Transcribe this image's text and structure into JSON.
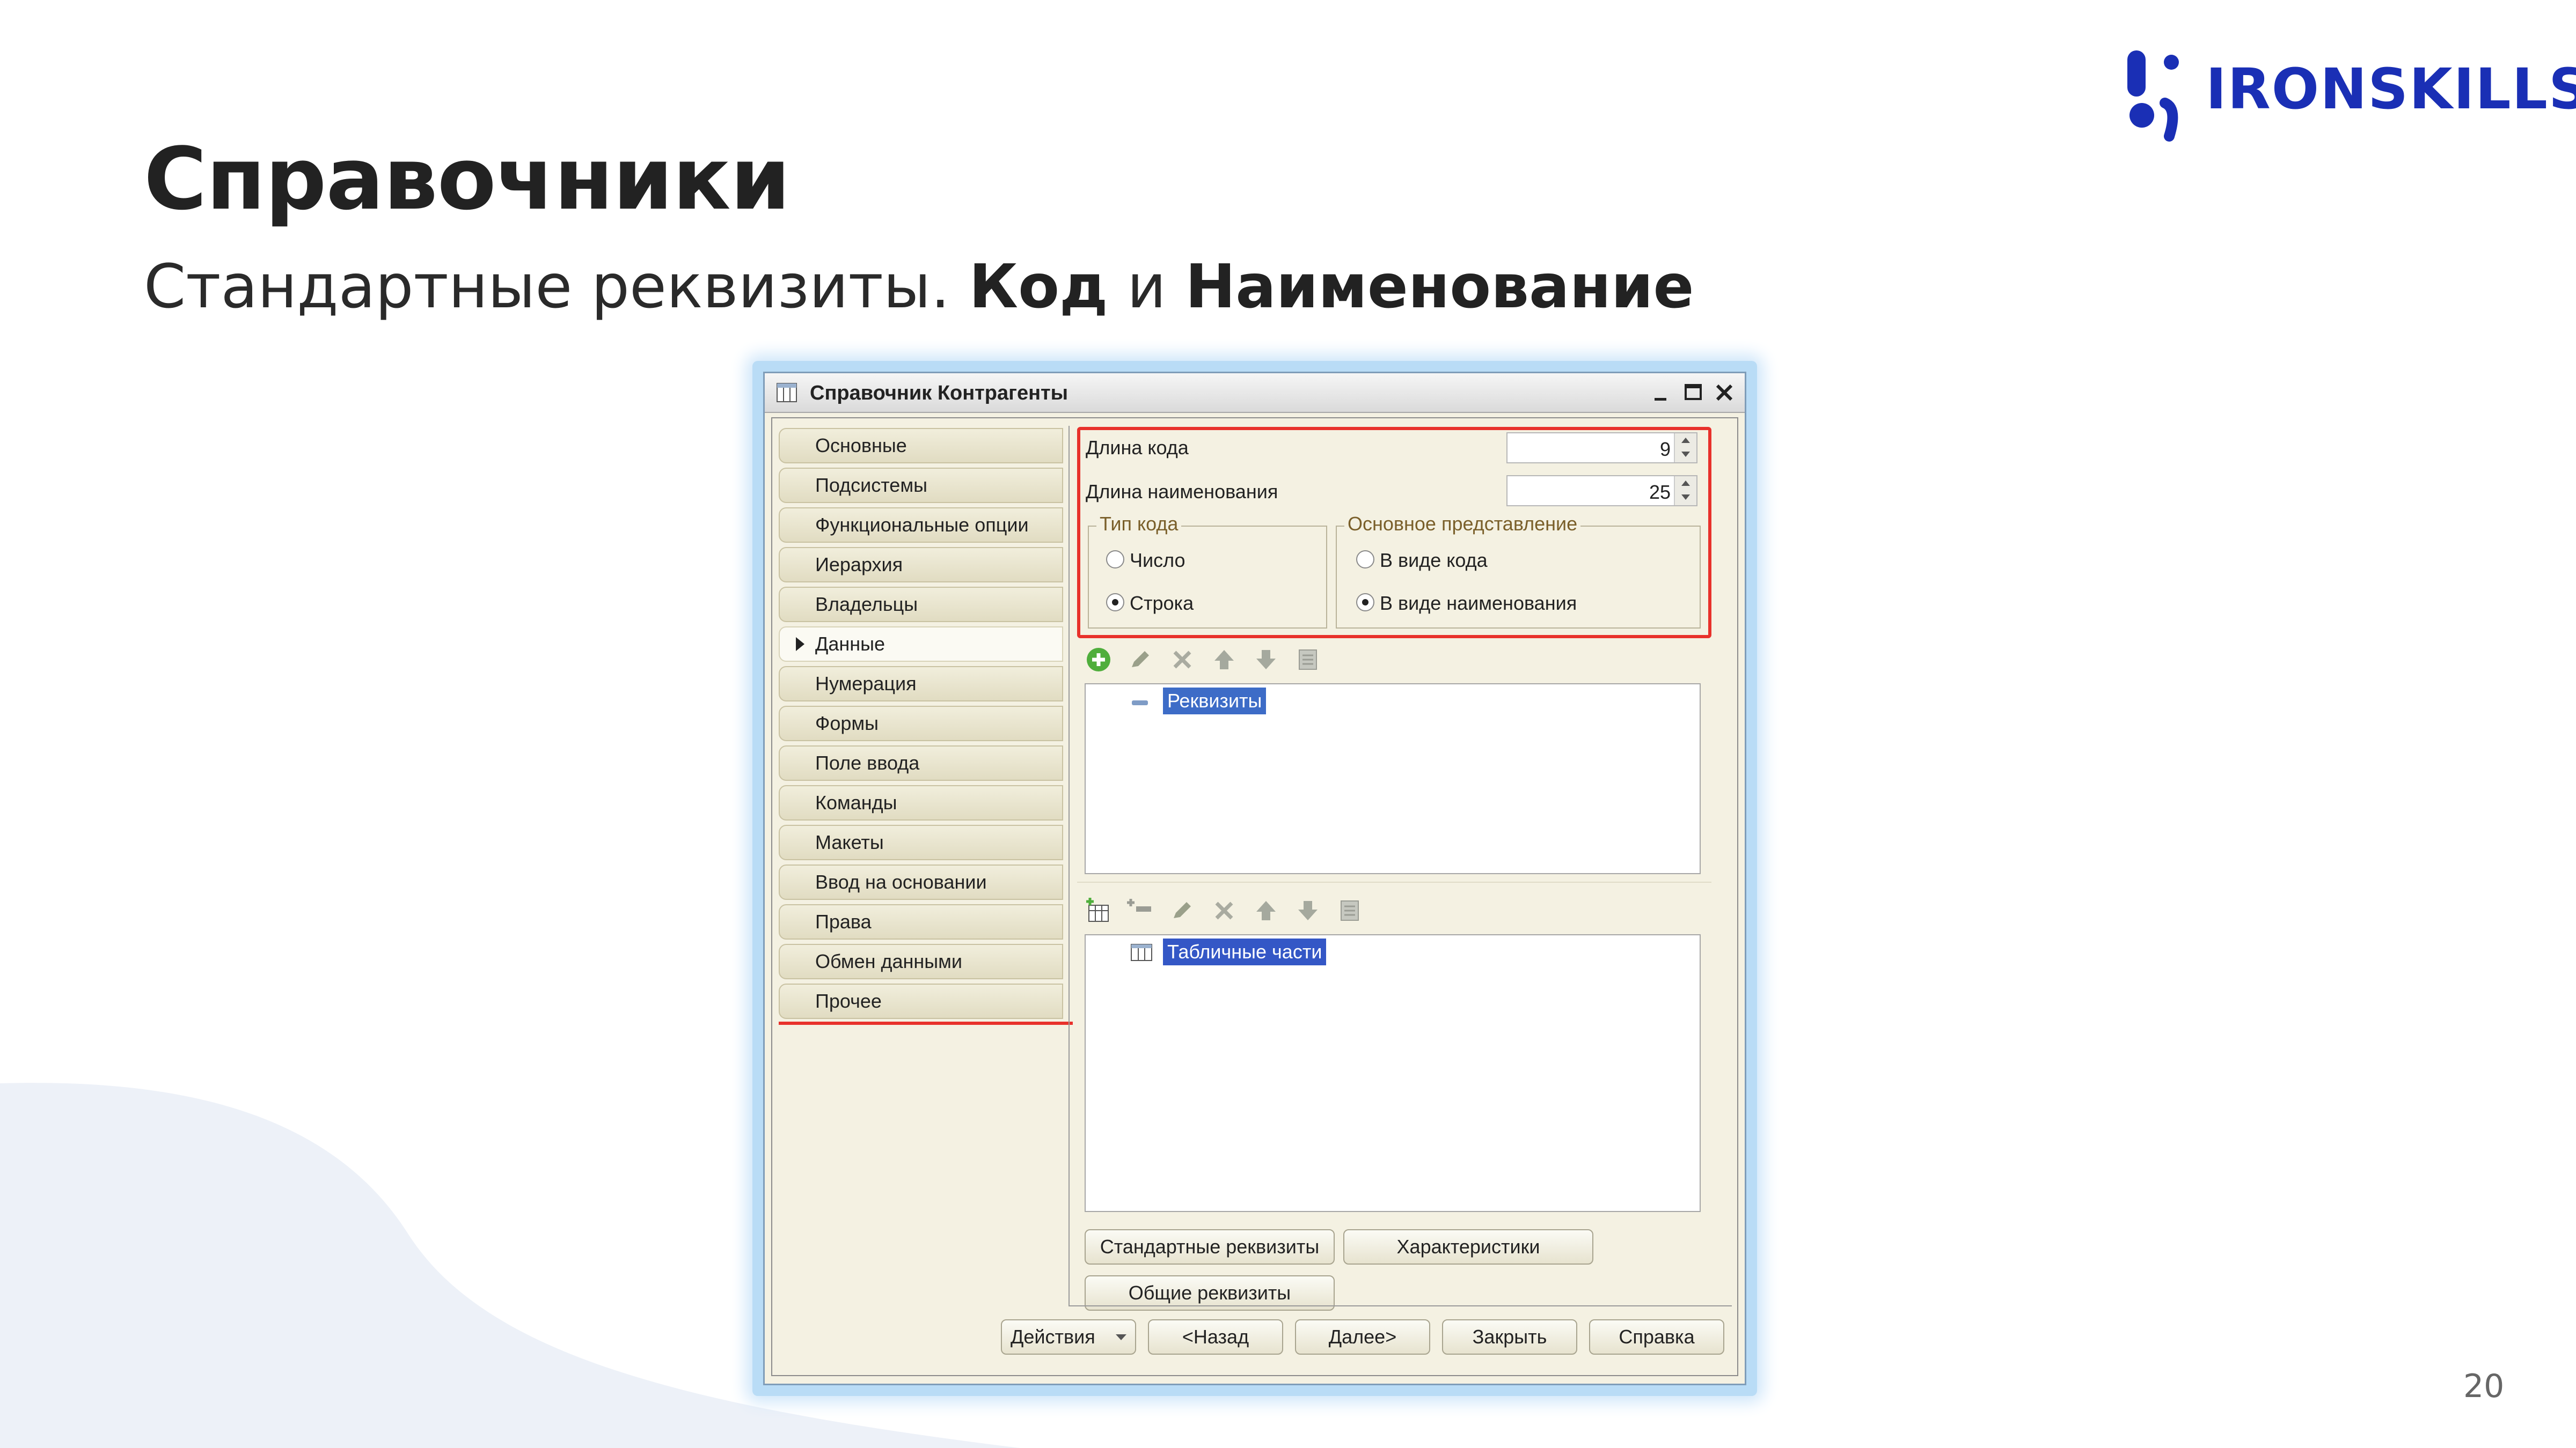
{
  "slide": {
    "title": "Справочники",
    "subtitle_prefix": "Стандартные реквизиты.",
    "subtitle_bold1": "Код",
    "subtitle_and": "и",
    "subtitle_bold2": "Наименование",
    "page_number": "20",
    "logo_text": "IRONSKILLS"
  },
  "colors": {
    "brand": "#1a2fb5",
    "highlight": "#e8312b",
    "selection": "#3d6cc7"
  },
  "window": {
    "title": "Справочник Контрагенты",
    "nav": [
      {
        "label": "Основные"
      },
      {
        "label": "Подсистемы"
      },
      {
        "label": "Функциональные опции"
      },
      {
        "label": "Иерархия"
      },
      {
        "label": "Владельцы"
      },
      {
        "label": "Данные",
        "active": true
      },
      {
        "label": "Нумерация"
      },
      {
        "label": "Формы"
      },
      {
        "label": "Поле ввода"
      },
      {
        "label": "Команды"
      },
      {
        "label": "Макеты"
      },
      {
        "label": "Ввод на основании"
      },
      {
        "label": "Права"
      },
      {
        "label": "Обмен данными"
      },
      {
        "label": "Прочее"
      }
    ],
    "fields": {
      "code_length_label": "Длина кода",
      "code_length_value": "9",
      "name_length_label": "Длина наименования",
      "name_length_value": "25"
    },
    "code_type": {
      "legend": "Тип кода",
      "options": [
        "Число",
        "Строка"
      ],
      "selected": "Строка"
    },
    "main_presentation": {
      "legend": "Основное представление",
      "options": [
        "В виде кода",
        "В виде наименования"
      ],
      "selected": "В виде наименования"
    },
    "attributes_tree": {
      "root": "Реквизиты"
    },
    "tabular_tree": {
      "root": "Табличные части"
    },
    "buttons": {
      "standard_attributes": "Стандартные реквизиты",
      "characteristics": "Характеристики",
      "common_attributes": "Общие реквизиты"
    },
    "footer": {
      "actions": "Действия",
      "back": "<Назад",
      "next": "Далее>",
      "close": "Закрыть",
      "help": "Справка"
    }
  }
}
